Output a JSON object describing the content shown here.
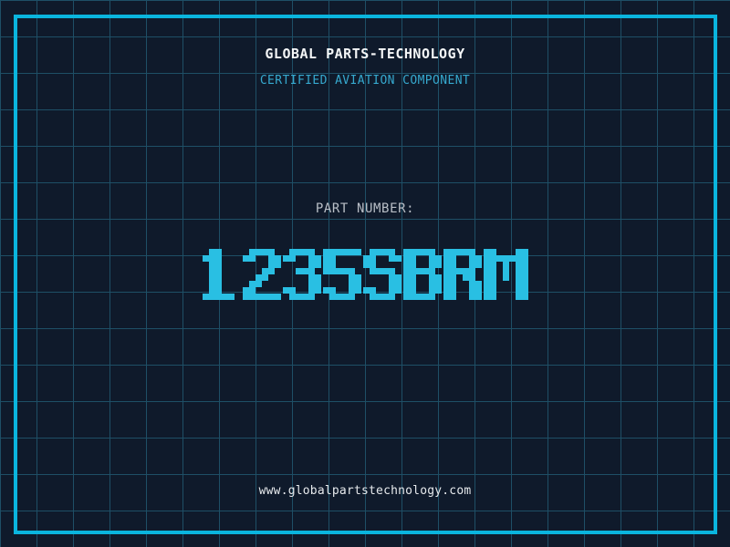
{
  "colors": {
    "background": "#0f1a2b",
    "grid_line": "#1e4f66",
    "frame": "#0ab5de",
    "title": "#f4f6f7",
    "subtitle": "#36a9cf",
    "part_label": "#b9bfc7",
    "part_number": "#29bfe3",
    "footer": "#e6e9ec"
  },
  "header": {
    "title": "GLOBAL PARTS-TECHNOLOGY",
    "subtitle": "CERTIFIED AVIATION COMPONENT"
  },
  "part": {
    "label": "PART NUMBER:",
    "number": "1235SBRM"
  },
  "footer": {
    "url": "www.globalpartstechnology.com"
  }
}
